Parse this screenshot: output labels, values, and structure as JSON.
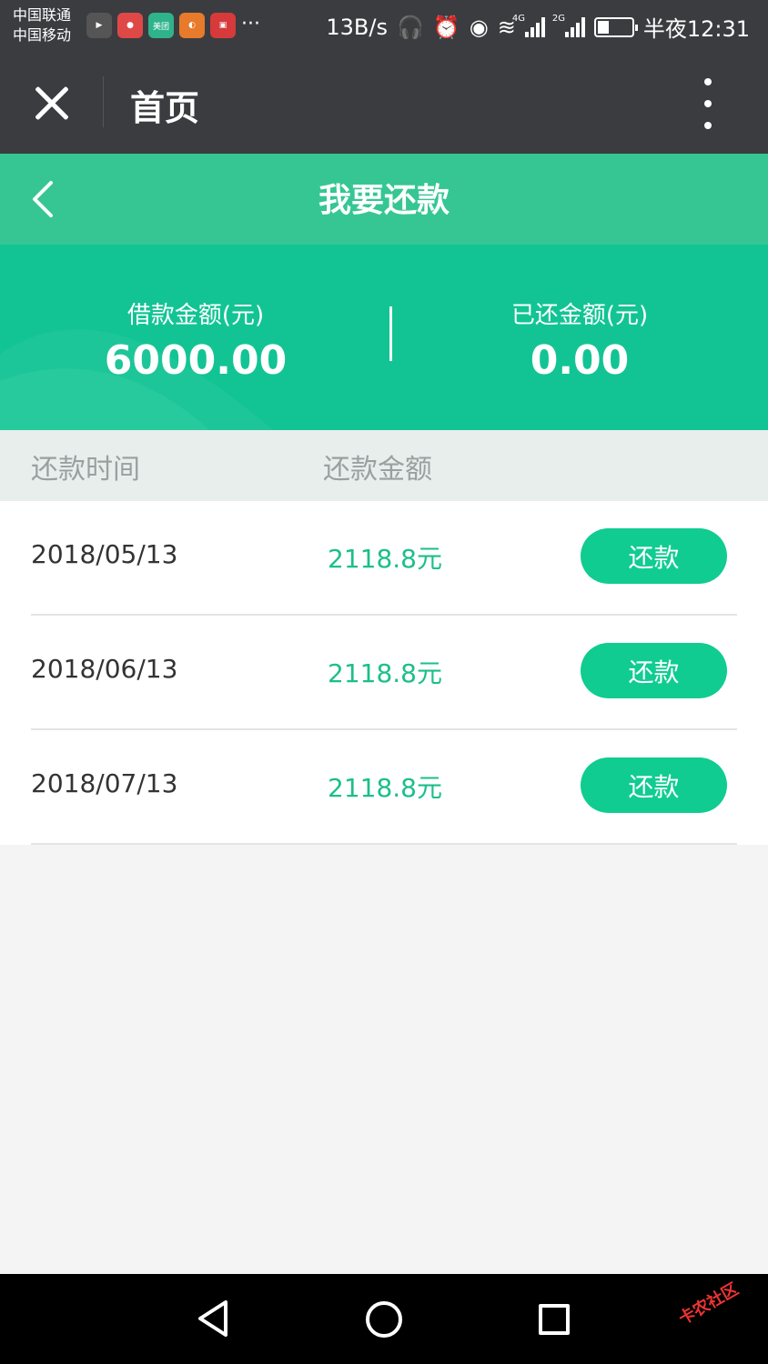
{
  "status_bar": {
    "carrier_1": "中国联通",
    "carrier_2": "中国移动",
    "app_icons": [
      {
        "name": "video-app-icon",
        "label": "",
        "color": "#555555"
      },
      {
        "name": "chat-app-icon",
        "label": "",
        "color": "#e04848"
      },
      {
        "name": "meituan-app-icon",
        "label": "美团",
        "color": "#2fb38a"
      },
      {
        "name": "weibo-app-icon",
        "label": "",
        "color": "#e87a2b"
      },
      {
        "name": "shop-app-icon",
        "label": "",
        "color": "#d63a3a"
      }
    ],
    "more": "···",
    "net_speed": "13B/s",
    "network_1": "4G",
    "network_2": "2G",
    "time": "半夜12:31"
  },
  "topbar": {
    "title": "首页"
  },
  "header": {
    "title": "我要还款"
  },
  "summary": {
    "loan_label": "借款金额(元)",
    "loan_value": "6000.00",
    "repaid_label": "已还金额(元)",
    "repaid_value": "0.00"
  },
  "table": {
    "col_date": "还款时间",
    "col_amount": "还款金额",
    "rows": [
      {
        "date": "2018/05/13",
        "amount": "2118.8元",
        "action": "还款"
      },
      {
        "date": "2018/06/13",
        "amount": "2118.8元",
        "action": "还款"
      },
      {
        "date": "2018/07/13",
        "amount": "2118.8元",
        "action": "还款"
      }
    ]
  },
  "watermark": "卡农社区",
  "colors": {
    "dark_bar": "#3b3c40",
    "header_green": "#35c694",
    "summary_green": "#12c494",
    "button_green": "#10cc91",
    "amount_green": "#1bbf8a"
  }
}
